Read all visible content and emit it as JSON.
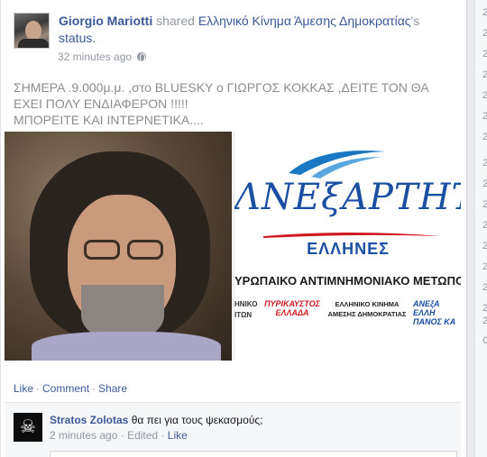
{
  "post": {
    "author": "Giorgio Mariotti",
    "action": "shared",
    "page": "Ελληνικό Κίνημα Άμεσης Δημοκρατίας",
    "possessive": "'s",
    "object": "status.",
    "time": "32 minutes ago",
    "privacy_icon": "globe-icon",
    "message": [
      "ΣΗΜΕΡΑ .9.000μ.μ. ,στο BLUESKY ο ΓΙΩΡΓΟΣ ΚΟΚΚΑΣ ,ΔΕΙΤΕ ΤΟΝ ΘΑ",
      "ΕΧΕΙ ΠΟΛΥ ΕΝΔΙΑΦΕΡΟΝ !!!!!",
      "ΜΠΟΡΕΙΤΕ ΚΑΙ ΙΝΤΕΡΝΕΤΙΚΑ...."
    ],
    "logo": {
      "title": "ΛΝΕξΑΡΤΗΤΟΙ",
      "subtitle": "ΕΛΛΗΝΕΣ",
      "front": "ΥΡΩΠΑΙΚΟ ΑΝΤΙΜΝΗΜΟΝΙΑΚΟ ΜΕΤΩΠΟ",
      "partner_a": "ΗΝΙΚΟ ΙΤΩΝ",
      "partner_b": "ΠΥΡΙΚΑΥΣΤΟΣ ΕΛΛΑΔΑ",
      "partner_c": "ΕΛΛΗΝΙΚΟ ΚΙΝΗΜΑ ΑΜΕΣΗΣ ΔΗΜΟΚΡΑΤΙΑΣ",
      "partner_d": "ΑΝΕξΑ ΕΛΛΗ ΠΑΝΟΣ ΚΑ"
    },
    "actions": {
      "like": "Like",
      "comment": "Comment",
      "share": "Share"
    }
  },
  "comment": {
    "author": "Stratos Zolotas",
    "text": "θα πει για τους ψεκασμούς;",
    "time": "2 minutes ago",
    "edited": "Edited",
    "like": "Like",
    "avatar_icon": "skull-icon"
  },
  "right_column": [
    "2",
    "2",
    "2",
    "2",
    "2",
    "2",
    "2",
    "2",
    "2",
    "2",
    "2",
    "2",
    "2",
    "2",
    "2",
    "2",
    "C"
  ]
}
